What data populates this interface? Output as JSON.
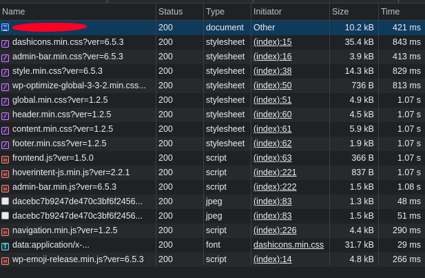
{
  "columns": {
    "name": "Name",
    "status": "Status",
    "type": "Type",
    "initiator": "Initiator",
    "size": "Size",
    "time": "Time"
  },
  "rows": [
    {
      "icon": "document-icon",
      "name": "",
      "redacted": true,
      "status": "200",
      "type": "document",
      "initiator": "Other",
      "initiator_link": false,
      "size": "10.2 kB",
      "time": "421 ms",
      "selected": true
    },
    {
      "icon": "stylesheet-icon",
      "name": "dashicons.min.css?ver=6.5.3",
      "status": "200",
      "type": "stylesheet",
      "initiator": "(index):15",
      "initiator_link": true,
      "size": "35.4 kB",
      "time": "843 ms"
    },
    {
      "icon": "stylesheet-icon",
      "name": "admin-bar.min.css?ver=6.5.3",
      "status": "200",
      "type": "stylesheet",
      "initiator": "(index):16",
      "initiator_link": true,
      "size": "3.9 kB",
      "time": "413 ms"
    },
    {
      "icon": "stylesheet-icon",
      "name": "style.min.css?ver=6.5.3",
      "status": "200",
      "type": "stylesheet",
      "initiator": "(index):38",
      "initiator_link": true,
      "size": "14.3 kB",
      "time": "829 ms"
    },
    {
      "icon": "stylesheet-icon",
      "name": "wp-optimize-global-3-3-2.min.css...",
      "status": "200",
      "type": "stylesheet",
      "initiator": "(index):50",
      "initiator_link": true,
      "size": "736 B",
      "time": "813 ms"
    },
    {
      "icon": "stylesheet-icon",
      "name": "global.min.css?ver=1.2.5",
      "status": "200",
      "type": "stylesheet",
      "initiator": "(index):51",
      "initiator_link": true,
      "size": "4.9 kB",
      "time": "1.07 s"
    },
    {
      "icon": "stylesheet-icon",
      "name": "header.min.css?ver=1.2.5",
      "status": "200",
      "type": "stylesheet",
      "initiator": "(index):60",
      "initiator_link": true,
      "size": "4.5 kB",
      "time": "1.07 s"
    },
    {
      "icon": "stylesheet-icon",
      "name": "content.min.css?ver=1.2.5",
      "status": "200",
      "type": "stylesheet",
      "initiator": "(index):61",
      "initiator_link": true,
      "size": "5.9 kB",
      "time": "1.07 s"
    },
    {
      "icon": "stylesheet-icon",
      "name": "footer.min.css?ver=1.2.5",
      "status": "200",
      "type": "stylesheet",
      "initiator": "(index):62",
      "initiator_link": true,
      "size": "1.9 kB",
      "time": "1.07 s"
    },
    {
      "icon": "script-icon",
      "name": "frontend.js?ver=1.5.0",
      "status": "200",
      "type": "script",
      "initiator": "(index):63",
      "initiator_link": true,
      "size": "366 B",
      "time": "1.07 s"
    },
    {
      "icon": "script-icon",
      "name": "hoverintent-js.min.js?ver=2.2.1",
      "status": "200",
      "type": "script",
      "initiator": "(index):221",
      "initiator_link": true,
      "size": "837 B",
      "time": "1.07 s"
    },
    {
      "icon": "script-icon",
      "name": "admin-bar.min.js?ver=6.5.3",
      "status": "200",
      "type": "script",
      "initiator": "(index):222",
      "initiator_link": true,
      "size": "1.5 kB",
      "time": "1.08 s"
    },
    {
      "icon": "image-icon",
      "name": "dacebc7b9247de470c3bf6f2456...",
      "status": "200",
      "type": "jpeg",
      "initiator": "(index):83",
      "initiator_link": true,
      "size": "1.3 kB",
      "time": "48 ms"
    },
    {
      "icon": "image-icon",
      "name": "dacebc7b9247de470c3bf6f2456...",
      "status": "200",
      "type": "jpeg",
      "initiator": "(index):83",
      "initiator_link": true,
      "size": "1.5 kB",
      "time": "51 ms"
    },
    {
      "icon": "script-icon",
      "name": "navigation.min.js?ver=1.2.5",
      "status": "200",
      "type": "script",
      "initiator": "(index):226",
      "initiator_link": true,
      "size": "4.4 kB",
      "time": "290 ms"
    },
    {
      "icon": "font-icon",
      "name": "data:application/x-...",
      "status": "200",
      "type": "font",
      "initiator": "dashicons.min.css",
      "initiator_link": true,
      "size": "31.7 kB",
      "time": "29 ms"
    },
    {
      "icon": "script-icon",
      "name": "wp-emoji-release.min.js?ver=6.5.3",
      "status": "200",
      "type": "script",
      "initiator": "(index):14",
      "initiator_link": true,
      "size": "4.8 kB",
      "time": "266 ms"
    }
  ]
}
